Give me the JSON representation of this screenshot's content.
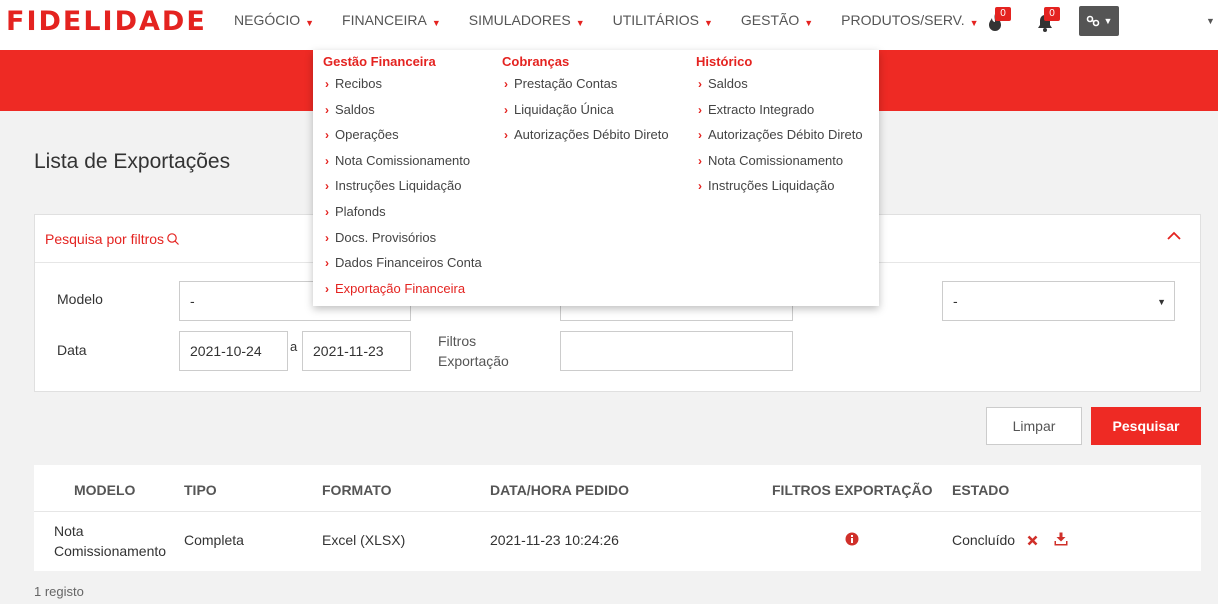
{
  "brand": {
    "logo_text": "FIDELIDADE",
    "accent": "#e42320"
  },
  "nav": {
    "items": [
      {
        "label": "NEGÓCIO"
      },
      {
        "label": "FINANCEIRA"
      },
      {
        "label": "SIMULADORES"
      },
      {
        "label": "UTILITÁRIOS"
      },
      {
        "label": "GESTÃO"
      },
      {
        "label": "PRODUTOS/SERV."
      }
    ],
    "tasks_badge": "0",
    "notifications_badge": "0"
  },
  "menu": {
    "columns": [
      {
        "heading": "Gestão Financeira",
        "items": [
          "Recibos",
          "Saldos",
          "Operações",
          "Nota Comissionamento",
          "Instruções Liquidação",
          "Plafonds",
          "Docs. Provisórios",
          "Dados Financeiros Conta",
          "Exportação Financeira"
        ]
      },
      {
        "heading": "Cobranças",
        "items": [
          "Prestação Contas",
          "Liquidação Única",
          "Autorizações Débito Direto"
        ]
      },
      {
        "heading": "Histórico",
        "items": [
          "Saldos",
          "Extracto Integrado",
          "Autorizações Débito Direto",
          "Nota Comissionamento",
          "Instruções Liquidação"
        ]
      }
    ],
    "active_item": "Exportação Financeira"
  },
  "page": {
    "title": "Lista de Exportações"
  },
  "filters": {
    "header": "Pesquisa por filtros",
    "modelo_label": "Modelo",
    "modelo_value": "-",
    "right_select_value": "-",
    "data_label": "Data",
    "date_from": "2021-10-24",
    "date_sep": "a",
    "date_to": "2021-11-23",
    "filtros_label_1": "Filtros",
    "filtros_label_2": "Exportação",
    "filtros_value": ""
  },
  "buttons": {
    "clear": "Limpar",
    "search": "Pesquisar"
  },
  "table": {
    "headers": [
      "MODELO",
      "TIPO",
      "FORMATO",
      "DATA/HORA PEDIDO",
      "FILTROS EXPORTAÇÃO",
      "ESTADO"
    ],
    "rows": [
      {
        "modelo_line1": "Nota",
        "modelo_line2": "Comissionamento",
        "tipo": "Completa",
        "formato": "Excel (XLSX)",
        "data_hora": "2021-11-23 10:24:26",
        "estado": "Concluído"
      }
    ]
  },
  "footer": {
    "count": "1 registo"
  }
}
